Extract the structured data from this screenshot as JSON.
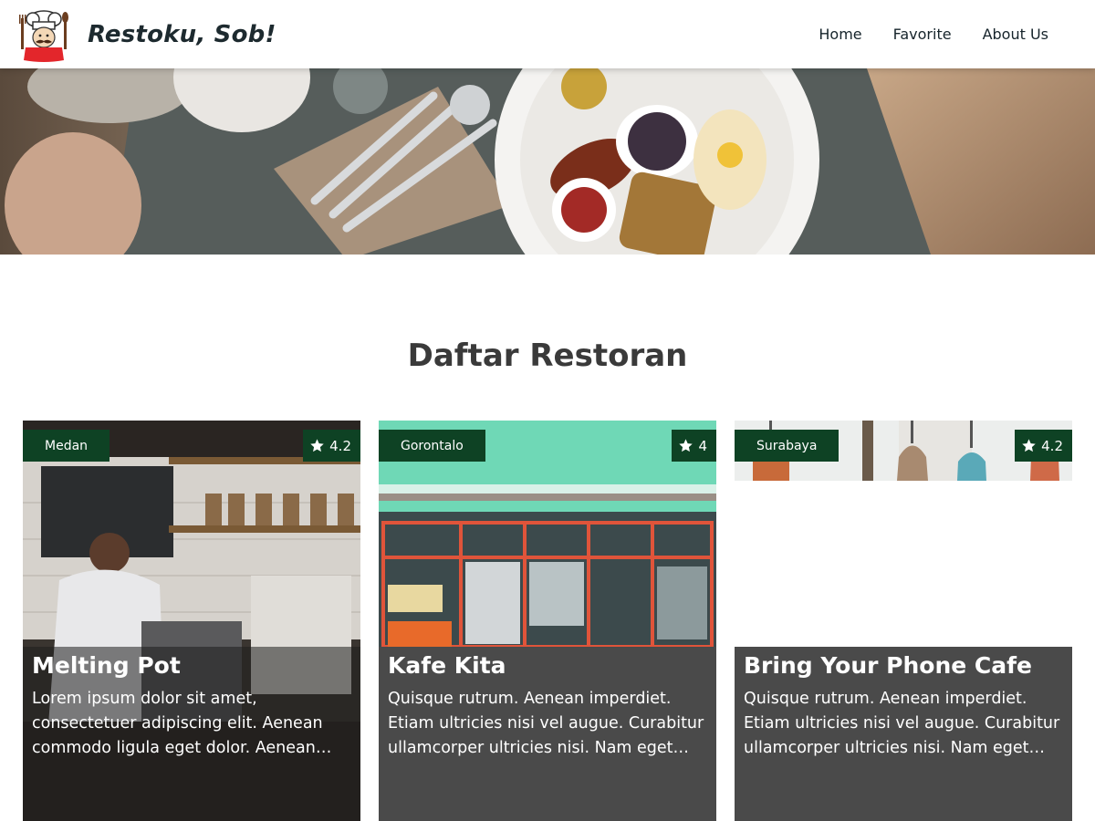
{
  "header": {
    "brand": "Restoku, Sob!",
    "logo_icon": "chef-mascot-logo",
    "nav": [
      {
        "label": "Home"
      },
      {
        "label": "Favorite"
      },
      {
        "label": "About Us"
      }
    ]
  },
  "hero": {
    "image": "breakfast-table-photo"
  },
  "main": {
    "title": "Daftar Restoran",
    "restaurants": [
      {
        "city": "Medan",
        "rating": "4.2",
        "name": "Melting Pot",
        "description": "Lorem ipsum dolor sit amet, consectetuer adipiscing elit. Aenean commodo ligula eget dolor. Aenean massa.",
        "image": "cafe-barista-photo"
      },
      {
        "city": "Gorontalo",
        "rating": "4",
        "name": "Kafe Kita",
        "description": "Quisque rutrum. Aenean imperdiet. Etiam ultricies nisi vel augue. Curabitur ullamcorper ultricies nisi. Nam eget dui.",
        "image": "storefront-photo"
      },
      {
        "city": "Surabaya",
        "rating": "4.2",
        "name": "Bring Your Phone Cafe",
        "description": "Quisque rutrum. Aenean imperdiet. Etiam ultricies nisi vel augue. Curabitur ullamcorper ultricies nisi. Nam eget dui.",
        "image": "pendant-lamps-photo"
      }
    ]
  },
  "colors": {
    "badge_bg": "#0e4224",
    "info_bg": "#4a4a4a",
    "title_text": "#3a3a3a"
  }
}
